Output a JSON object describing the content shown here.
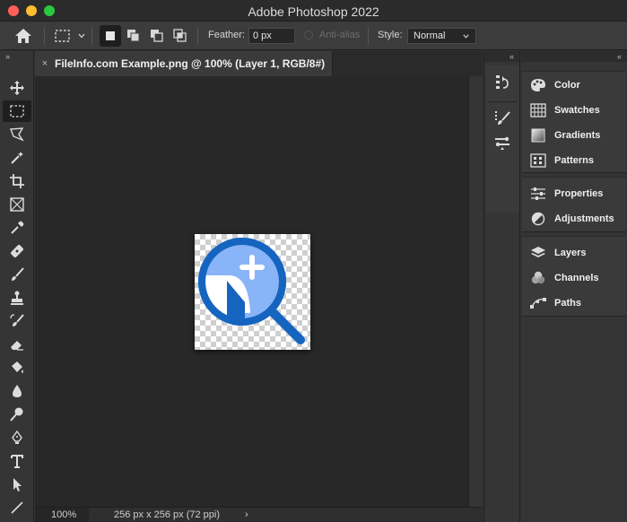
{
  "window": {
    "title": "Adobe Photoshop 2022"
  },
  "options_bar": {
    "feather_label": "Feather:",
    "feather_value": "0 px",
    "antialias_label": "Anti-alias",
    "style_label": "Style:",
    "style_value": "Normal"
  },
  "document": {
    "tab_title": "FileInfo.com Example.png @ 100% (Layer 1, RGB/8#)",
    "close_glyph": "×"
  },
  "status_bar": {
    "zoom": "100%",
    "doc_size": "256 px x 256 px (72 ppi)",
    "arrow": "›"
  },
  "panel_collapse": {
    "left": "»",
    "mid": "«",
    "right": "«"
  },
  "right_panel": {
    "group1": [
      {
        "label": "Color",
        "icon": "color-palette-icon"
      },
      {
        "label": "Swatches",
        "icon": "swatches-grid-icon"
      },
      {
        "label": "Gradients",
        "icon": "gradient-icon"
      },
      {
        "label": "Patterns",
        "icon": "patterns-icon"
      }
    ],
    "group2": [
      {
        "label": "Properties",
        "icon": "sliders-icon"
      },
      {
        "label": "Adjustments",
        "icon": "half-circle-icon"
      }
    ],
    "group3": [
      {
        "label": "Layers",
        "icon": "layers-icon"
      },
      {
        "label": "Channels",
        "icon": "channels-icon"
      },
      {
        "label": "Paths",
        "icon": "paths-icon"
      }
    ]
  },
  "colors": {
    "app_bg": "#323232",
    "canvas_bg": "#282828",
    "logo_blue_dark": "#1565c0",
    "logo_blue_light": "#8ab4f8"
  }
}
